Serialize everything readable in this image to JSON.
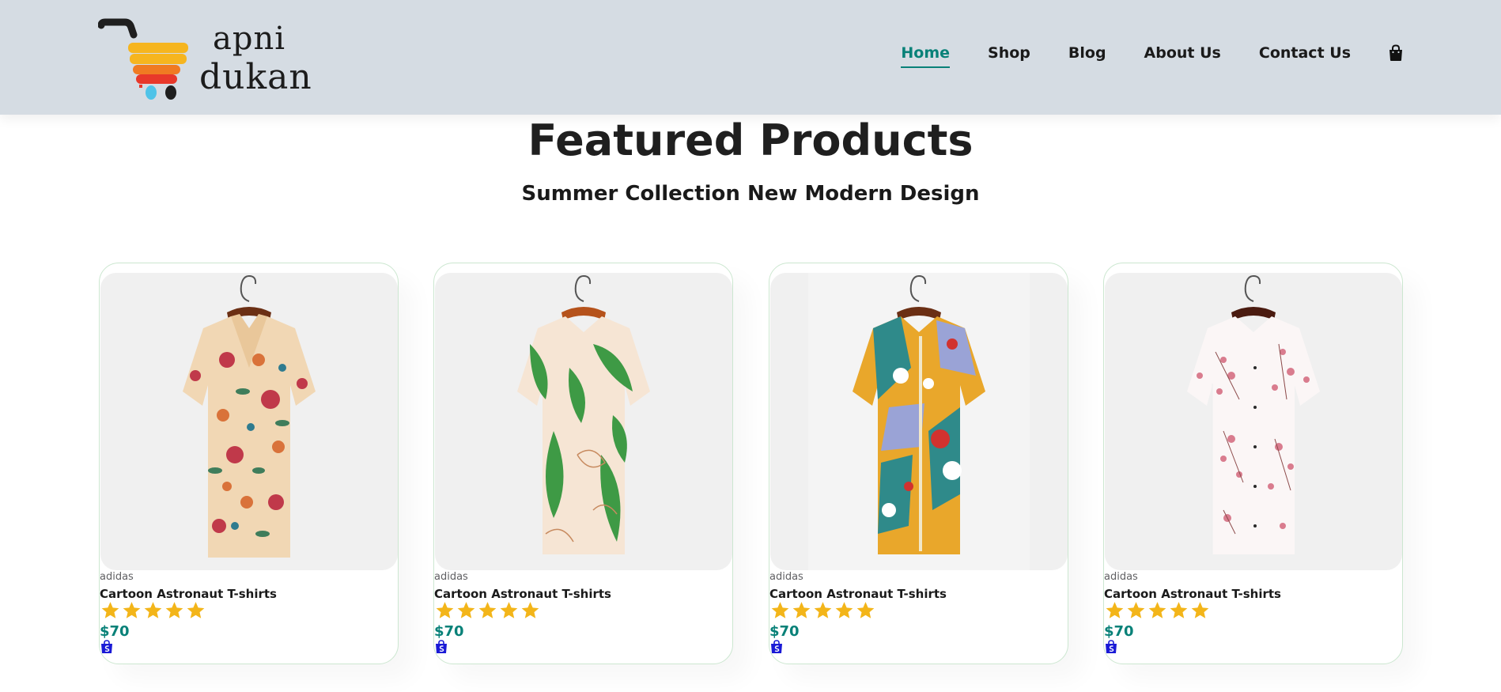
{
  "header": {
    "logo": {
      "line1": "apni",
      "line2": "dukan"
    },
    "nav": [
      {
        "label": "Home",
        "active": true
      },
      {
        "label": "Shop",
        "active": false
      },
      {
        "label": "Blog",
        "active": false
      },
      {
        "label": "About Us",
        "active": false
      },
      {
        "label": "Contact Us",
        "active": false
      }
    ],
    "cart_icon": "shopping-bag-icon"
  },
  "main": {
    "title": "Featured Products",
    "subtitle": "Summer Collection New Modern Design"
  },
  "products": [
    {
      "brand": "adidas",
      "name": "Cartoon Astronaut T-shirts",
      "rating": 5,
      "price": "$70",
      "image": "floral-beige-shirt"
    },
    {
      "brand": "adidas",
      "name": "Cartoon Astronaut T-shirts",
      "rating": 5,
      "price": "$70",
      "image": "leaf-print-shirt"
    },
    {
      "brand": "adidas",
      "name": "Cartoon Astronaut T-shirts",
      "rating": 5,
      "price": "$70",
      "image": "abstract-color-shirt"
    },
    {
      "brand": "adidas",
      "name": "Cartoon Astronaut T-shirts",
      "rating": 5,
      "price": "$70",
      "image": "white-blossom-shirt"
    }
  ],
  "colors": {
    "header_bg": "#d5dce3",
    "accent": "#088178",
    "star": "#f3b519",
    "card_border": "#cce7d0",
    "cart_icon": "#1a1ad6"
  }
}
